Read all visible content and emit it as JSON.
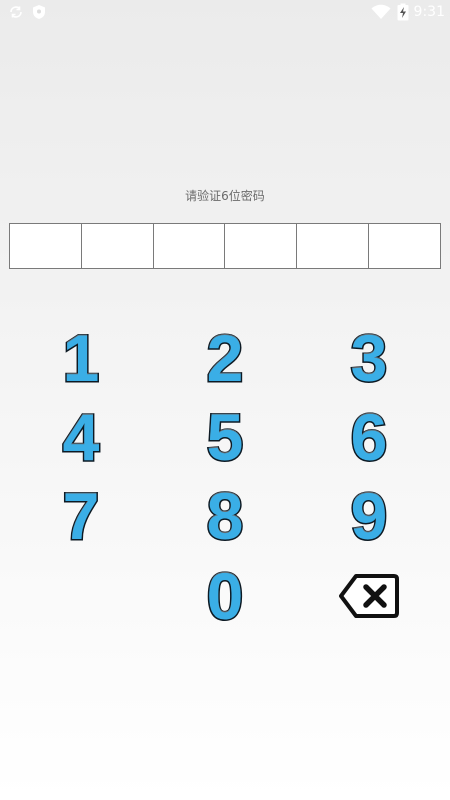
{
  "status_bar": {
    "time": "9:31",
    "left_icons": [
      "sync-icon",
      "shield-icon"
    ],
    "right_icons": [
      "wifi-icon",
      "battery-charging-icon"
    ]
  },
  "prompt": "请验证6位密码",
  "pin": {
    "length": 6,
    "entered": 0
  },
  "keypad": {
    "keys": [
      {
        "label": "1"
      },
      {
        "label": "2"
      },
      {
        "label": "3"
      },
      {
        "label": "4"
      },
      {
        "label": "5"
      },
      {
        "label": "6"
      },
      {
        "label": "7"
      },
      {
        "label": "8"
      },
      {
        "label": "9"
      },
      {
        "label": ""
      },
      {
        "label": "0"
      },
      {
        "label": "",
        "icon": "backspace-icon"
      }
    ]
  },
  "colors": {
    "digit_fill": "#3aaee6",
    "digit_outline": "#0d1a24",
    "prompt_text": "#6a6a6a",
    "pin_border": "#7a7a7a"
  }
}
